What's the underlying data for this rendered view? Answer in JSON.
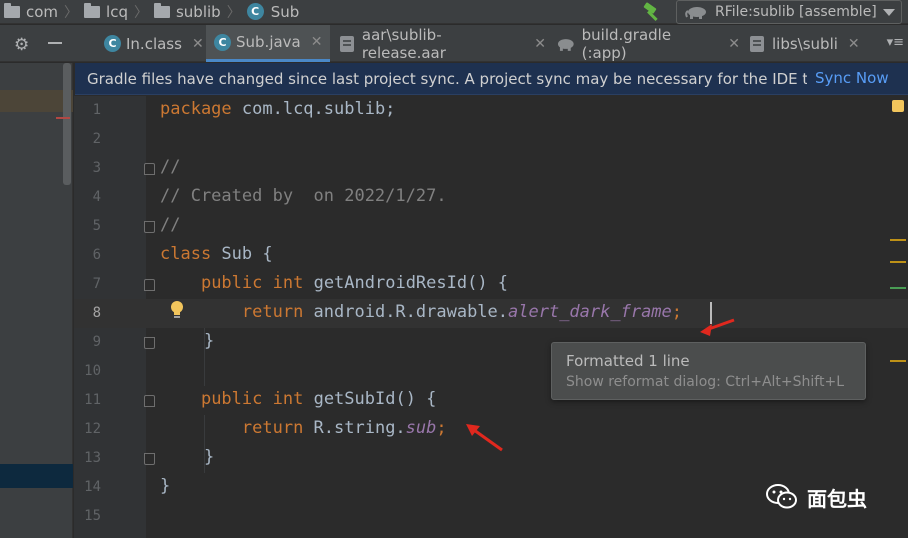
{
  "breadcrumb": {
    "items": [
      "com",
      "lcq",
      "sublib",
      "Sub"
    ]
  },
  "run_config": {
    "label": "RFile:sublib [assemble]"
  },
  "tabs": [
    {
      "label": "In.class",
      "active": false
    },
    {
      "label": "Sub.java",
      "active": true
    },
    {
      "label": "aar\\sublib-release.aar",
      "active": false
    },
    {
      "label": "build.gradle (:app)",
      "active": false
    },
    {
      "label": "libs\\subli",
      "active": false
    }
  ],
  "tab_overflow": "▾≡",
  "banner": {
    "message": "Gradle files have changed since last project sync. A project sync may be necessary for the IDE to work properly.",
    "action": "Sync Now"
  },
  "editor": {
    "current_line": 8,
    "lines": [
      {
        "n": "1",
        "text": "package com.lcq.sublib;"
      },
      {
        "n": "2",
        "text": ""
      },
      {
        "n": "3",
        "text": "//"
      },
      {
        "n": "4",
        "text": "// Created by  on 2022/1/27."
      },
      {
        "n": "5",
        "text": "//"
      },
      {
        "n": "6",
        "text": "class Sub {"
      },
      {
        "n": "7",
        "text": "    public int getAndroidResId() {"
      },
      {
        "n": "8",
        "text": "        return android.R.drawable.alert_dark_frame;"
      },
      {
        "n": "9",
        "text": "    }"
      },
      {
        "n": "10",
        "text": ""
      },
      {
        "n": "11",
        "text": "    public int getSubId() {"
      },
      {
        "n": "12",
        "text": "        return R.string.sub;"
      },
      {
        "n": "13",
        "text": "    }"
      },
      {
        "n": "14",
        "text": "}"
      },
      {
        "n": "15",
        "text": ""
      }
    ],
    "tokens": {
      "l1_kw": "package",
      "l1_rest": " com.lcq.sublib;",
      "l3": "//",
      "l4": "// Created by  on 2022/1/27.",
      "l5": "//",
      "l6_kw": "class",
      "l6_rest": " Sub {",
      "l7_kw1": "public",
      "l7_kw2": "int",
      "l7_rest": " getAndroidResId() {",
      "l8_kw": "return",
      "l8_mid": " android.R.drawable.",
      "l8_fld": "alert_dark_frame",
      "l8_end": ";",
      "l9": "}",
      "l11_kw1": "public",
      "l11_kw2": "int",
      "l11_rest": " getSubId() {",
      "l12_kw": "return",
      "l12_mid": " R.string.",
      "l12_fld": "sub",
      "l12_end": ";",
      "l13": "}",
      "l14": "}"
    }
  },
  "tooltip": {
    "title": "Formatted 1 line",
    "hint": "Show reformat dialog: Ctrl+Alt+Shift+L"
  },
  "watermark": {
    "text": "面包虫"
  },
  "colors": {
    "keyword": "#cc7832",
    "comment": "#808080",
    "field": "#9876aa",
    "plain": "#a9b7c6",
    "link": "#589df6",
    "annotation_arrow": "#e0281e"
  }
}
